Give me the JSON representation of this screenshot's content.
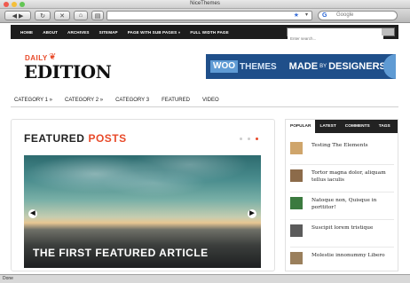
{
  "window": {
    "title": "NiceThemes",
    "status": "Done"
  },
  "toolbar": {
    "search_placeholder": "Google",
    "search_engine_icon": "G"
  },
  "topnav": {
    "items": [
      "HOME",
      "ABOUT",
      "ARCHIVES",
      "SITEMAP",
      "PAGE WITH SUB PAGES »",
      "FULL WIDTH PAGE"
    ],
    "search_placeholder": "Enter search..."
  },
  "logo": {
    "small": "DAILY",
    "large": "EDITION"
  },
  "banner": {
    "woo": "WOO",
    "themes": "THEMES",
    "made": "MADE",
    "by": "BY",
    "designers": "DESIGNERS"
  },
  "catnav": {
    "items": [
      "CATEGORY 1 »",
      "CATEGORY 2 »",
      "CATEGORY 3",
      "FEATURED",
      "VIDEO"
    ]
  },
  "featured": {
    "title_a": "FEATURED",
    "title_b": "POSTS",
    "caption": "THE FIRST FEATURED ARTICLE",
    "active_dot": 3
  },
  "sidebar": {
    "tabs": [
      "POPULAR",
      "LATEST",
      "COMMENTS",
      "TAGS"
    ],
    "posts": [
      "Testing The Elements",
      "Tortor magna dolor, aliquam tellus iaculis",
      "Natoque non, Quisque in porttitor!",
      "Suscipit lorem tristique",
      "Molestie innonummy Libero"
    ],
    "thumb_colors": [
      "#cfa56b",
      "#8c6b4a",
      "#3b7a3f",
      "#5b5b5b",
      "#9a7f5c"
    ]
  },
  "colors": {
    "accent": "#e84a2a",
    "nav_bg": "#1d1d1d",
    "banner_bg": "#1f4f8a"
  }
}
